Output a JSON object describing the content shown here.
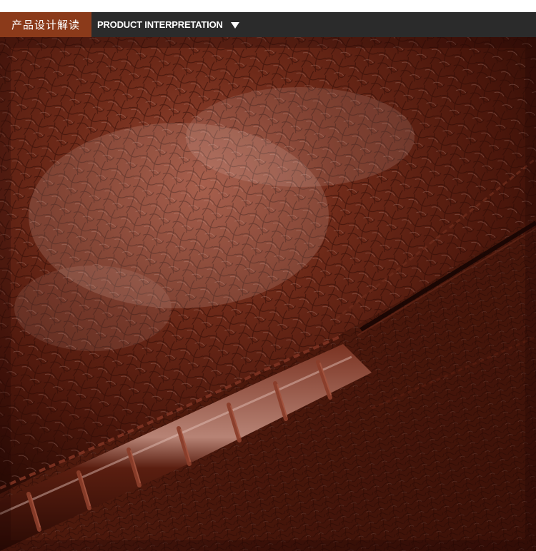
{
  "header": {
    "tag_label": "产品设计解读",
    "title": "PRODUCT INTERPRETATION",
    "arrow_icon": "triangle-down-icon",
    "tag_color": "#8b3a1a",
    "bar_color": "#2b2b2b"
  },
  "photo": {
    "subject": "leather-texture-closeup",
    "primary_color": "#5a1f10",
    "highlight_color": "#c9a59a",
    "stitch_color": "#8a3d2a"
  }
}
